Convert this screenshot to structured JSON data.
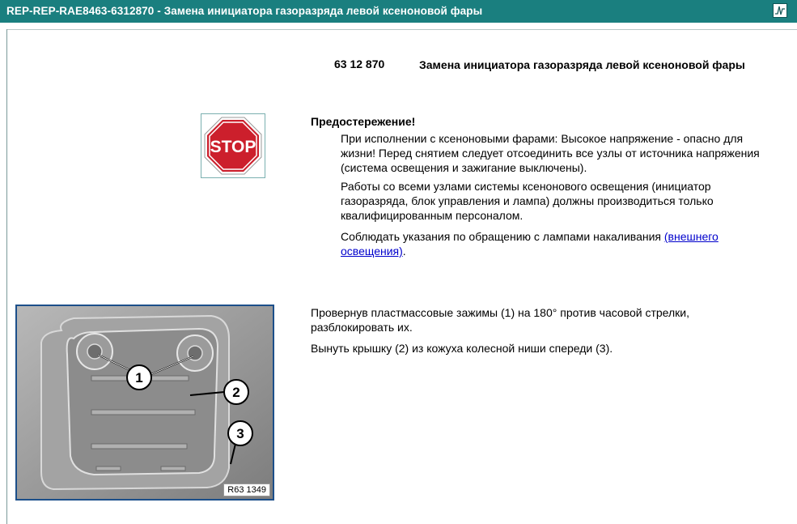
{
  "window": {
    "title": "REP-REP-RAE8463-6312870  -  Замена инициатора газоразряда левой ксеноновой фары",
    "title_icon": "waveform-icon"
  },
  "header": {
    "code": "63 12 870",
    "title": "Замена инициатора газоразряда левой ксеноновой фары"
  },
  "warning": {
    "icon": "stop-sign-icon",
    "stop_text": "STOP",
    "heading": "Предостережение!",
    "p1": "При исполнении с ксеноновыми фарами: Высокое напряжение - опасно для жизни! Перед снятием следует отсоединить все узлы от источника напряжения (система освещения и зажигание выключены).",
    "p2": "Работы со всеми узлами системы ксенонового освещения (инициатор газоразряда, блок управления и лампа) должны производиться только квалифицированным персоналом.",
    "p3_prefix": "Соблюдать указания по обращению с лампами накаливания ",
    "p3_link": "(внешнего освещения)",
    "p3_suffix": "."
  },
  "figure": {
    "id": "R63 1349",
    "callouts": [
      "1",
      "2",
      "3"
    ]
  },
  "steps": {
    "step1": "Провернув пластмассовые зажимы (1) на 180° против часовой стрелки, разблокировать их.",
    "step2": "Вынуть крышку (2) из кожуха колесной ниши спереди (3)."
  },
  "colors": {
    "titlebar": "#1a7f7f",
    "stop_red": "#cc1f2c",
    "link": "#0000cc",
    "figure_border": "#1c4f8a"
  }
}
